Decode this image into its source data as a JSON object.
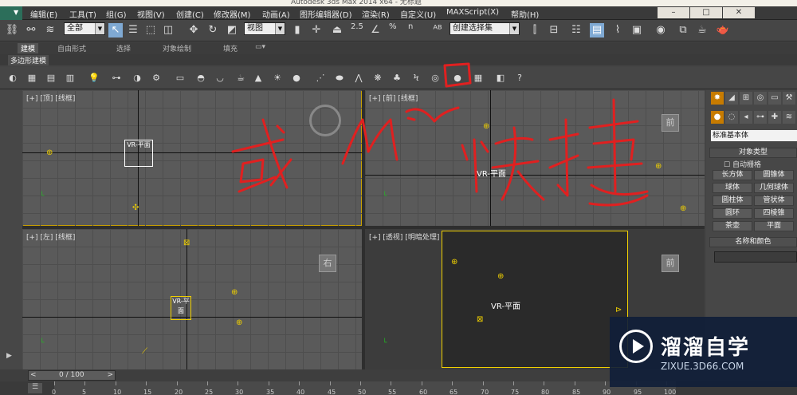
{
  "window": {
    "title": "Autodesk 3ds Max 2014 x64 - 无标题"
  },
  "menu": {
    "items": [
      "编辑(E)",
      "工具(T)",
      "组(G)",
      "视图(V)",
      "创建(C)",
      "修改器(M)",
      "动画(A)",
      "图形编辑器(D)",
      "渲染(R)",
      "自定义(U)",
      "MAXScript(X)",
      "帮助(H)"
    ]
  },
  "toolbar": {
    "filter_value": "全部",
    "view_value": "视图",
    "named_selection_value": "创建选择集",
    "snap_label": "2.5",
    "percent_snap_label": "%",
    "spinner_snap_label": "n"
  },
  "ribbon": {
    "tabs": [
      "建模",
      "自由形式",
      "选择",
      "对象绘制",
      "填充"
    ],
    "active_tab": "建模",
    "sub_label": "多边形建模"
  },
  "viewports": {
    "top_left": {
      "label": "[+] [顶] [线框]",
      "viewcube": ""
    },
    "top_right": {
      "label": "[+] [前] [线框]",
      "viewcube": "前"
    },
    "bottom_left": {
      "label": "[+] [左] [线框]",
      "viewcube": "右"
    },
    "bottom_right": {
      "label": "[+] [透视] [明暗处理]",
      "viewcube": "前"
    },
    "object_label": "VR-平面"
  },
  "command_panel": {
    "tabs": [
      "创建",
      "修改",
      "层次",
      "运动",
      "显示",
      "工具"
    ],
    "category": "标准基本体",
    "section_object_type": "对象类型",
    "autogrid_label": "自动栅格",
    "buttons": [
      "长方体",
      "圆锥体",
      "球体",
      "几何球体",
      "圆柱体",
      "管状体",
      "圆环",
      "四棱锥",
      "茶壶",
      "平面"
    ],
    "section_name_color": "名称和颜色"
  },
  "timeline": {
    "frame_display": "0 / 100",
    "prev": "<",
    "next": ">",
    "ticks": [
      "0",
      "5",
      "10",
      "15",
      "20",
      "25",
      "30",
      "35",
      "40",
      "45",
      "50",
      "55",
      "60",
      "65",
      "70",
      "75",
      "80",
      "85",
      "90",
      "95",
      "100"
    ]
  },
  "watermark": {
    "name": "溜溜自学",
    "url": "ZIXUE.3D66.COM"
  },
  "annotation": {
    "text": "或 M 快捷",
    "color": "#e02020"
  },
  "colors": {
    "accent_orange": "#c77b00",
    "active_blue": "#7fa9d3",
    "selection_yellow": "#f0d000",
    "viewport_bg": "#5a5a5a"
  }
}
